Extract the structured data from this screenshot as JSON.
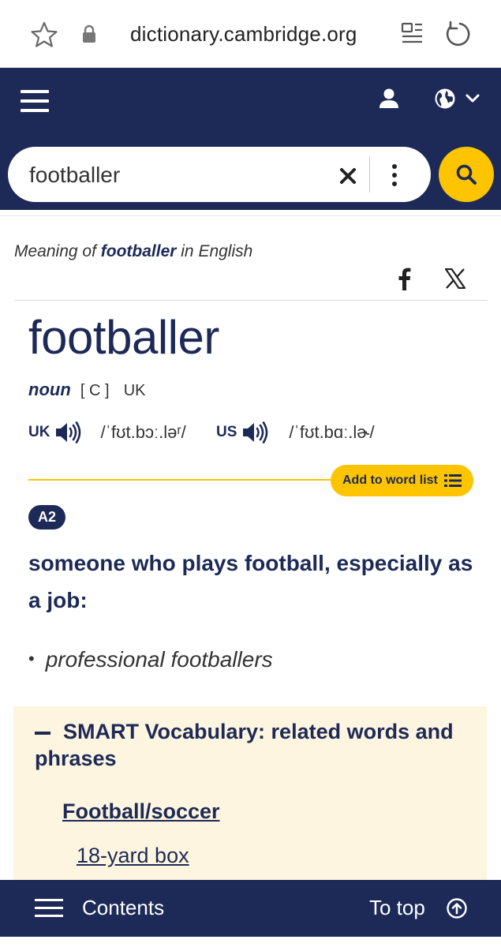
{
  "browser": {
    "url": "dictionary.cambridge.org"
  },
  "search": {
    "value": "footballer"
  },
  "entry": {
    "meaning_prefix": "Meaning of",
    "meaning_word": "footballer",
    "meaning_suffix": "in English",
    "headword": "footballer",
    "pos": "noun",
    "grammar": "[ C ]",
    "region": "UK",
    "pron_uk_label": "UK",
    "pron_uk_ipa": "/ˈfʊt.bɔː.ləʳ/",
    "pron_us_label": "US",
    "pron_us_ipa": "/ˈfʊt.bɑː.lɚ/",
    "add_word_list": "Add to word list",
    "level": "A2",
    "definition": "someone who plays football, especially as a job:",
    "example": "professional footballers"
  },
  "smart_vocab": {
    "title": "SMART Vocabulary: related words and phrases",
    "category": "Football/soccer",
    "items": [
      "18-yard box"
    ]
  },
  "bottombar": {
    "contents_label": "Contents",
    "top_label": "To top"
  },
  "colors": {
    "brand_navy": "#1d2a57",
    "accent_yellow": "#fec400",
    "smart_bg": "#fdf5df"
  }
}
